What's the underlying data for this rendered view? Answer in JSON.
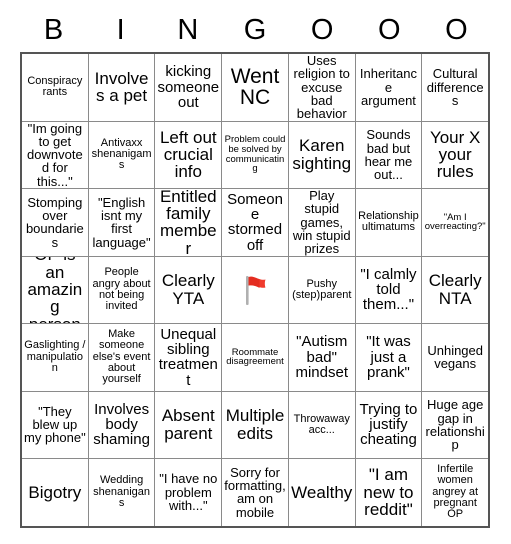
{
  "card": {
    "title": "BINGOOO",
    "header_letters": [
      "B",
      "I",
      "N",
      "G",
      "O",
      "O",
      "O"
    ],
    "columns": 7,
    "rows": 7,
    "colors": {
      "grid_line": "#8a8a8a",
      "grid_border": "#555555",
      "text": "#000000",
      "background": "#ffffff",
      "flag_red": "#f03b2d",
      "flag_pole": "#b0b0b0"
    },
    "cells": [
      [
        {
          "text": "Conspiracy rants",
          "size": "s"
        },
        {
          "text": "Involves a pet",
          "size": "xl"
        },
        {
          "text": "kicking someone out",
          "size": "l"
        },
        {
          "text": "Went NC",
          "size": "xxl"
        },
        {
          "text": "Uses religion to excuse bad behavior",
          "size": "m"
        },
        {
          "text": "Inheritance argument",
          "size": "m"
        },
        {
          "text": "Cultural differences",
          "size": "m"
        }
      ],
      [
        {
          "text": "\"Im going to get downvoted for this...\"",
          "size": "m"
        },
        {
          "text": "Antivaxx shenanigams",
          "size": "s"
        },
        {
          "text": "Left out crucial info",
          "size": "xl"
        },
        {
          "text": "Problem could be solved by communicating",
          "size": "xs"
        },
        {
          "text": "Karen sighting",
          "size": "xl"
        },
        {
          "text": "Sounds bad but hear me out...",
          "size": "m"
        },
        {
          "text": "Your X your rules",
          "size": "xl"
        }
      ],
      [
        {
          "text": "Stomping over boundaries",
          "size": "m"
        },
        {
          "text": "\"English isnt my first language\"",
          "size": "m"
        },
        {
          "text": "Entitled family member",
          "size": "xl"
        },
        {
          "text": "Someone stormed off",
          "size": "l"
        },
        {
          "text": "Play stupid games, win stupid prizes",
          "size": "m"
        },
        {
          "text": "Relationship ultimatums",
          "size": "s"
        },
        {
          "text": "\"Am I overreacting?\"",
          "size": "xs"
        }
      ],
      [
        {
          "text": "OP is an amazing person",
          "size": "xl"
        },
        {
          "text": "People angry about not being invited",
          "size": "s"
        },
        {
          "text": "Clearly YTA",
          "size": "xl"
        },
        {
          "text": "",
          "size": "m",
          "icon": "red-flag"
        },
        {
          "text": "Pushy (step)parent",
          "size": "s"
        },
        {
          "text": "\"I calmly told them...\"",
          "size": "l"
        },
        {
          "text": "Clearly NTA",
          "size": "xl"
        }
      ],
      [
        {
          "text": "Gaslighting / manipulation",
          "size": "s"
        },
        {
          "text": "Make someone else's event about yourself",
          "size": "s"
        },
        {
          "text": "Unequal sibling treatment",
          "size": "l"
        },
        {
          "text": "Roommate disagreement",
          "size": "xs"
        },
        {
          "text": "\"Autism bad\" mindset",
          "size": "l"
        },
        {
          "text": "\"It was just a prank\"",
          "size": "l"
        },
        {
          "text": "Unhinged vegans",
          "size": "m"
        }
      ],
      [
        {
          "text": "\"They blew up my phone\"",
          "size": "m"
        },
        {
          "text": "Involves body shaming",
          "size": "l"
        },
        {
          "text": "Absent parent",
          "size": "xl"
        },
        {
          "text": "Multiple edits",
          "size": "xl"
        },
        {
          "text": "Throwaway acc...",
          "size": "s"
        },
        {
          "text": "Trying to justify cheating",
          "size": "l"
        },
        {
          "text": "Huge age gap in relationship",
          "size": "m"
        }
      ],
      [
        {
          "text": "Bigotry",
          "size": "xl"
        },
        {
          "text": "Wedding shenanigans",
          "size": "s"
        },
        {
          "text": "\"I have no problem with...\"",
          "size": "m"
        },
        {
          "text": "Sorry for formatting, am on mobile",
          "size": "m"
        },
        {
          "text": "Wealthy",
          "size": "xl"
        },
        {
          "text": "\"I am new to reddit\"",
          "size": "xl"
        },
        {
          "text": "Infertile women angrey at pregnant OP",
          "size": "s"
        }
      ]
    ]
  }
}
